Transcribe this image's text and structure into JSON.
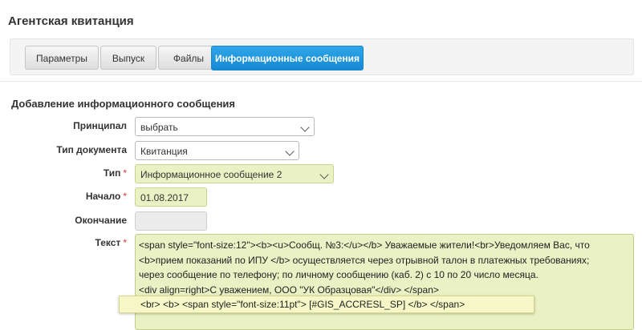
{
  "page": {
    "title": "Агентская квитанция"
  },
  "tabs": [
    {
      "label": "Параметры",
      "active": false
    },
    {
      "label": "Выпуск",
      "active": false
    },
    {
      "label": "Файлы",
      "active": false
    },
    {
      "label": "Информационные сообщения",
      "active": true
    }
  ],
  "form": {
    "title": "Добавление информационного сообщения",
    "required_mark": "*",
    "principal": {
      "label": "Принципал",
      "value": "выбрать"
    },
    "doc_type": {
      "label": "Тип документа",
      "value": "Квитанция"
    },
    "type": {
      "label": "Тип",
      "value": "Информационное сообщение 2"
    },
    "start": {
      "label": "Начало",
      "value": "01.08.2017"
    },
    "end": {
      "label": "Окончание",
      "value": ""
    },
    "text": {
      "label": "Текст",
      "lines": [
        "<span style=\"font-size:12\"><b><u>Сообщ. №3:</u></b> Уважаемые жители!<br>Уведомляем Вас, что",
        "<b>прием показаний по ИПУ </b>  осуществляется через отрывной талон в платежных требованиях;",
        "через сообщение по телефону; по личному сообщению (каб. 2) с 10 по 20 число месяца.",
        "<div align=right>С уважением, ООО \"УК Образцовая\"</div> </span>"
      ]
    },
    "tooltip": "<br> <b> <span style=\"font-size:11pt\"> [#GIS_ACCRESL_SP] </b> </span>"
  },
  "colors": {
    "accent": "#1a8fd8",
    "highlight": "#eaf1c4",
    "required": "#dd3333"
  }
}
